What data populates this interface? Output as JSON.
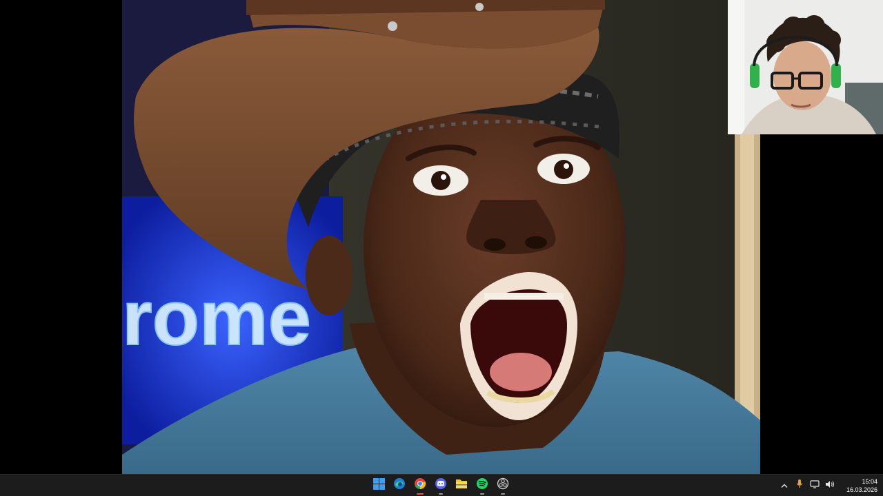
{
  "screen": {
    "background": "#000000"
  },
  "viewer": {
    "content": "photo",
    "background_sign_text": "rome"
  },
  "webcam": {
    "content": "webcam-feed"
  },
  "taskbar": {
    "background": "#1c1c1c",
    "pinned": [
      {
        "name": "windows-start",
        "icon": "windows-logo-icon",
        "running": false
      },
      {
        "name": "edge",
        "icon": "edge-icon",
        "running": false
      },
      {
        "name": "chrome",
        "icon": "chrome-icon",
        "running": true
      },
      {
        "name": "discord",
        "icon": "discord-icon",
        "running": true
      },
      {
        "name": "file-explorer",
        "icon": "folder-icon",
        "running": false
      },
      {
        "name": "spotify",
        "icon": "spotify-icon",
        "running": true
      },
      {
        "name": "obs",
        "icon": "obs-icon",
        "running": true
      }
    ],
    "tray": {
      "icons": [
        "chevron-up-icon",
        "microphone-icon",
        "network-icon",
        "speaker-icon"
      ],
      "time": "15:04",
      "date": "16.03.2026"
    }
  }
}
